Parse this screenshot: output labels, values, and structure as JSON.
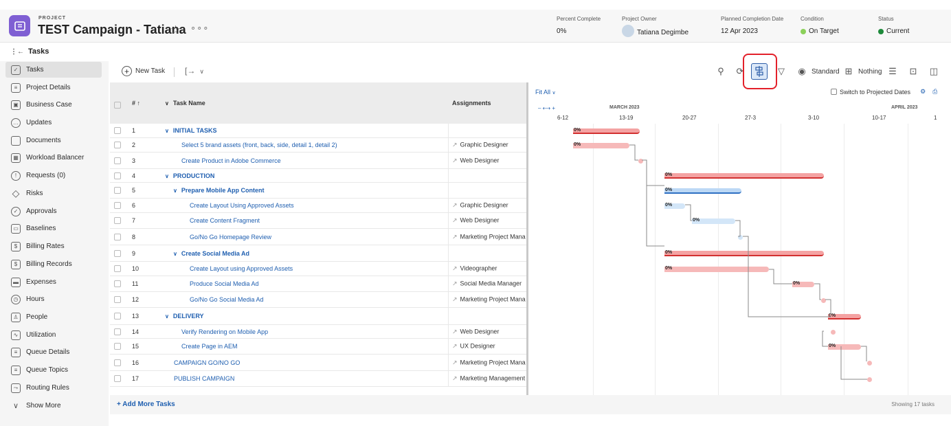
{
  "project": {
    "label": "PROJECT",
    "title": "TEST Campaign - Tatiana",
    "star": "☆",
    "more": "∘∘∘"
  },
  "meta": {
    "percent_label": "Percent Complete",
    "percent_value": "0%",
    "owner_label": "Project Owner",
    "owner_value": "Tatiana Degimbe",
    "planned_label": "Planned Completion Date",
    "planned_value": "12 Apr 2023",
    "condition_label": "Condition",
    "condition_value": "On Target",
    "condition_color": "#8bd05a",
    "status_label": "Status",
    "status_value": "Current",
    "status_color": "#1e8a3b"
  },
  "nav": {
    "heading": "Tasks",
    "items": [
      {
        "label": "Tasks",
        "icon": "checkbox-icon"
      },
      {
        "label": "Project Details",
        "icon": "document-lines-icon"
      },
      {
        "label": "Business Case",
        "icon": "briefcase-icon"
      },
      {
        "label": "Updates",
        "icon": "chat-icon"
      },
      {
        "label": "Documents",
        "icon": "file-icon"
      },
      {
        "label": "Workload Balancer",
        "icon": "calendar-icon"
      },
      {
        "label": "Requests (0)",
        "icon": "request-icon"
      },
      {
        "label": "Risks",
        "icon": "diamond-icon"
      },
      {
        "label": "Approvals",
        "icon": "check-circle-icon"
      },
      {
        "label": "Baselines",
        "icon": "baseline-icon"
      },
      {
        "label": "Billing Rates",
        "icon": "billing-rates-icon"
      },
      {
        "label": "Billing Records",
        "icon": "billing-records-icon"
      },
      {
        "label": "Expenses",
        "icon": "expenses-icon"
      },
      {
        "label": "Hours",
        "icon": "clock-icon"
      },
      {
        "label": "People",
        "icon": "people-icon"
      },
      {
        "label": "Utilization",
        "icon": "chart-icon"
      },
      {
        "label": "Queue Details",
        "icon": "queue-details-icon"
      },
      {
        "label": "Queue Topics",
        "icon": "queue-topics-icon"
      },
      {
        "label": "Routing Rules",
        "icon": "routing-icon"
      },
      {
        "label": "Show More",
        "icon": "chevron-down-icon"
      }
    ]
  },
  "toolbar": {
    "new_task": "New Task",
    "standard": "Standard",
    "nothing": "Nothing"
  },
  "table": {
    "col_num": "# ↑",
    "col_name": "Task Name",
    "col_assign": "Assignments",
    "rows": [
      {
        "num": "1",
        "name": "INITIAL TASKS",
        "assign": "",
        "level": 0,
        "parent": true
      },
      {
        "num": "2",
        "name": "Select 5 brand assets (front, back, side, detail 1, detail 2)",
        "assign": "Graphic Designer",
        "level": 1,
        "parent": false
      },
      {
        "num": "3",
        "name": "Create Product in Adobe Commerce",
        "assign": "Web Designer",
        "level": 1,
        "parent": false
      },
      {
        "num": "4",
        "name": "PRODUCTION",
        "assign": "",
        "level": 0,
        "parent": true
      },
      {
        "num": "5",
        "name": "Prepare Mobile App Content",
        "assign": "",
        "level": 1,
        "parent": true
      },
      {
        "num": "6",
        "name": "Create Layout Using Approved Assets",
        "assign": "Graphic Designer",
        "level": 2,
        "parent": false
      },
      {
        "num": "7",
        "name": "Create Content Fragment",
        "assign": "Web Designer",
        "level": 2,
        "parent": false
      },
      {
        "num": "8",
        "name": "Go/No Go Homepage Review",
        "assign": "Marketing Project Mana",
        "level": 2,
        "parent": false
      },
      {
        "num": "9",
        "name": "Create Social Media Ad",
        "assign": "",
        "level": 1,
        "parent": true
      },
      {
        "num": "10",
        "name": "Create Layout using Approved Assets",
        "assign": "Videographer",
        "level": 2,
        "parent": false
      },
      {
        "num": "11",
        "name": "Produce Social Media Ad",
        "assign": "Social Media Manager",
        "level": 2,
        "parent": false
      },
      {
        "num": "12",
        "name": "Go/No Go Social Media Ad",
        "assign": "Marketing Project Mana",
        "level": 2,
        "parent": false
      },
      {
        "num": "13",
        "name": "DELIVERY",
        "assign": "",
        "level": 0,
        "parent": true
      },
      {
        "num": "14",
        "name": "Verify Rendering on Mobile App",
        "assign": "Web Designer",
        "level": 1,
        "parent": false
      },
      {
        "num": "15",
        "name": "Create Page in AEM",
        "assign": "UX Designer",
        "level": 1,
        "parent": false
      },
      {
        "num": "16",
        "name": "CAMPAIGN GO/NO GO",
        "assign": "Marketing Project Mana",
        "level": 0,
        "parent": false
      },
      {
        "num": "17",
        "name": "PUBLISH CAMPAIGN",
        "assign": "Marketing Management",
        "level": 0,
        "parent": false
      }
    ],
    "add_more": "+ Add More Tasks",
    "showing": "Showing 17 tasks"
  },
  "gantt": {
    "fit_all": "Fit All",
    "switch_label": "Switch to Projected Dates",
    "zoom": "– ⟷ +",
    "month_1": "MARCH 2023",
    "month_2": "APRIL 2023",
    "weeks": [
      "6-12",
      "13-19",
      "20-27",
      "27-3",
      "3-10",
      "10-17",
      "1"
    ],
    "pct": "0%",
    "colors": {
      "red": "#d23030",
      "blue": "#2d6fc2",
      "pink": "#f6b9b9"
    }
  }
}
